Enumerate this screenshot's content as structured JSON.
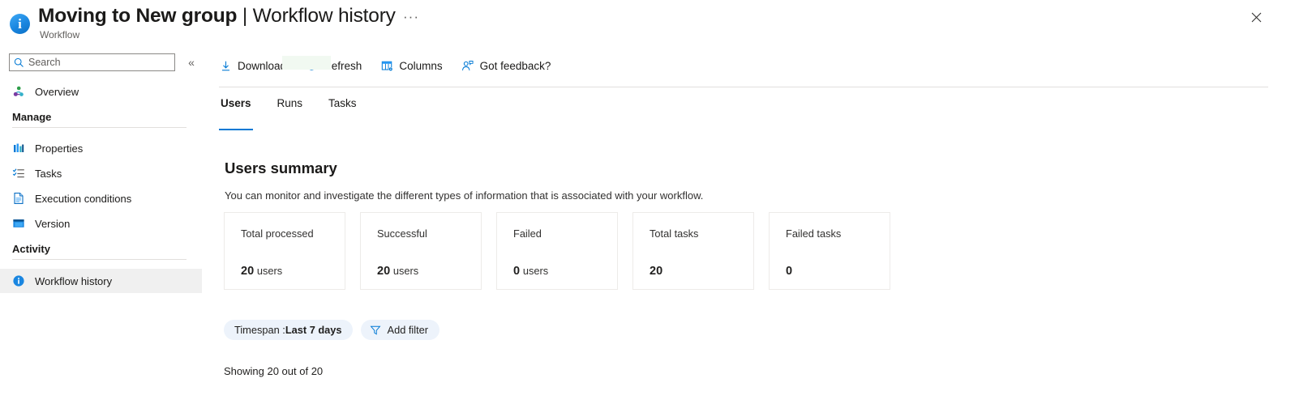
{
  "header": {
    "icon": "info-circle-icon",
    "title_main": "Moving to New group",
    "title_separator": " | ",
    "title_section": "Workflow history",
    "overflow_label": "···",
    "subtitle": "Workflow",
    "close_label": "close-icon"
  },
  "sidebar": {
    "search": {
      "value": "",
      "placeholder": "Search",
      "icon": "search-icon"
    },
    "collapse_label": "«",
    "overview": {
      "label": "Overview",
      "icon": "overview-icon"
    },
    "groups": [
      {
        "title": "Manage",
        "items": [
          {
            "label": "Properties",
            "icon": "properties-bars-icon"
          },
          {
            "label": "Tasks",
            "icon": "tasks-checklist-icon"
          },
          {
            "label": "Execution conditions",
            "icon": "document-icon"
          },
          {
            "label": "Version",
            "icon": "version-window-icon"
          }
        ]
      },
      {
        "title": "Activity",
        "items": [
          {
            "label": "Workflow history",
            "icon": "info-circle-icon",
            "selected": true
          }
        ]
      }
    ]
  },
  "toolbar": {
    "buttons": [
      {
        "label": "Download",
        "icon": "download-arrow-icon"
      },
      {
        "label": "Refresh",
        "icon": "refresh-circular-arrow-icon"
      },
      {
        "label": "Columns",
        "icon": "columns-table-gear-icon"
      },
      {
        "label": "Got feedback?",
        "icon": "person-feedback-icon"
      }
    ]
  },
  "tabs": [
    {
      "label": "Users",
      "active": true
    },
    {
      "label": "Runs",
      "active": false
    },
    {
      "label": "Tasks",
      "active": false
    }
  ],
  "summary": {
    "title": "Users summary",
    "description": "You can monitor and investigate the different types of information that is associated with your workflow.",
    "cards": [
      {
        "title": "Total processed",
        "value": "20",
        "unit": "users"
      },
      {
        "title": "Successful",
        "value": "20",
        "unit": "users"
      },
      {
        "title": "Failed",
        "value": "0",
        "unit": "users"
      },
      {
        "title": "Total tasks",
        "value": "20",
        "unit": ""
      },
      {
        "title": "Failed tasks",
        "value": "0",
        "unit": ""
      }
    ]
  },
  "filters": {
    "timespan_key": "Timespan : ",
    "timespan_value": "Last 7 days",
    "add_filter_label": "Add filter",
    "add_filter_icon": "filter-funnel-icon"
  },
  "footer": {
    "showing": "Showing 20 out of 20"
  },
  "colors": {
    "accent": "#0078d4",
    "chip_bg": "#edf3fb",
    "selected_nav_bg": "#f0f0f0",
    "download_highlight": "#f1f9f1",
    "card_border": "#edebe9",
    "rule": "#e1dfdd",
    "text": "#1b1a19",
    "muted_text": "#605e5c"
  }
}
